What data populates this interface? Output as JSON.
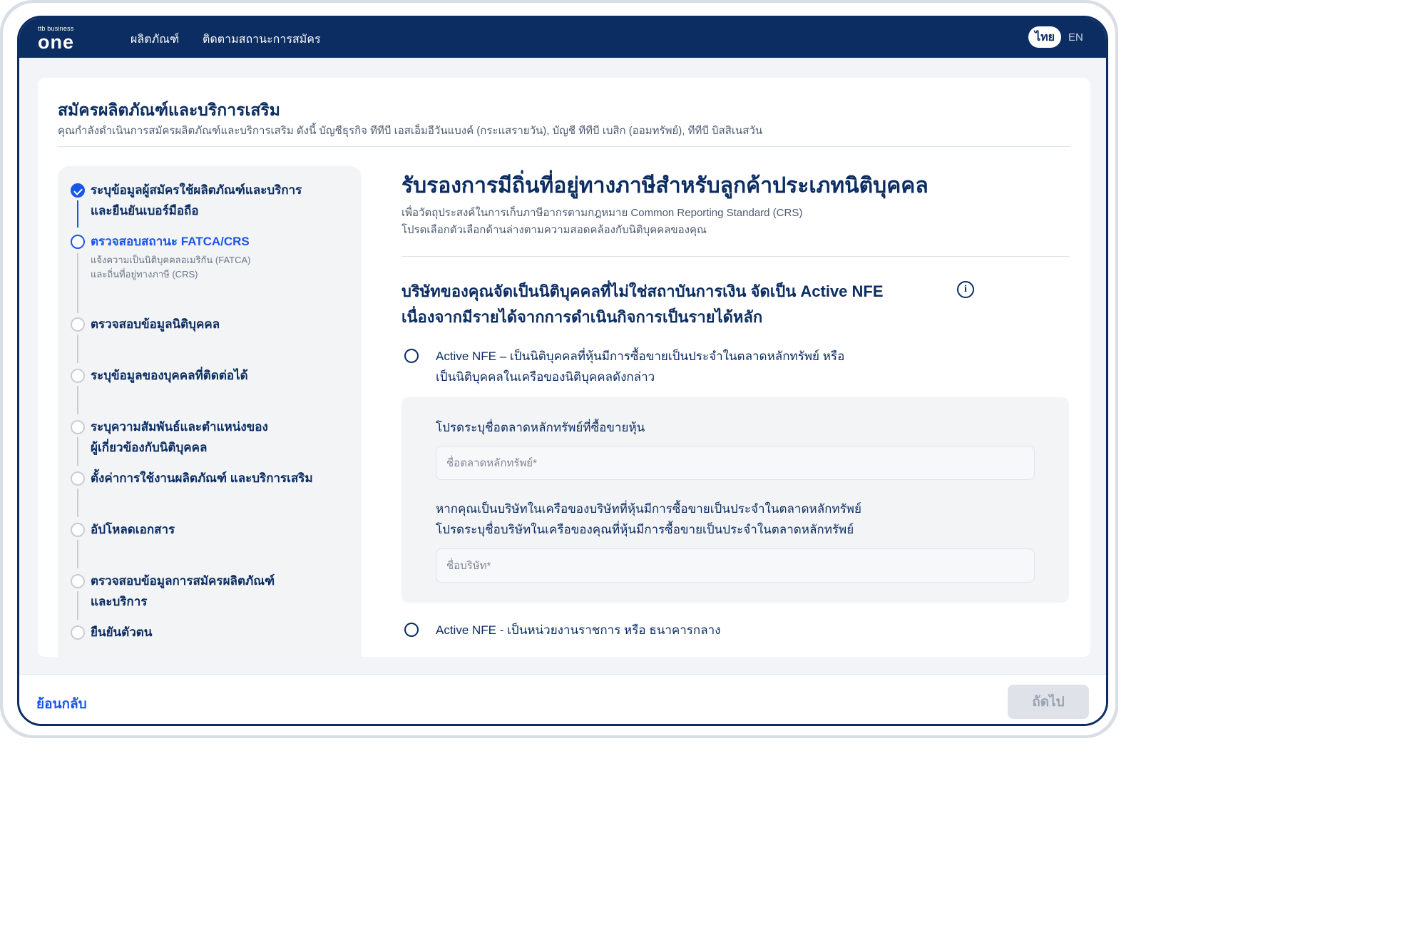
{
  "header": {
    "logo_small": "ttb business",
    "logo_big": "one",
    "nav": [
      "ผลิตภัณฑ์",
      "ติดตามสถานะการสมัคร"
    ],
    "lang_active": "ไทย",
    "lang_other": "EN"
  },
  "page": {
    "title": "สมัครผลิตภัณฑ์และบริการเสริม",
    "subtitle": "คุณกำลังดำเนินการสมัครผลิตภัณฑ์และบริการเสริม ดังนี้  บัญชีธุรกิจ ทีทีบี เอสเอ็มอีวันแบงค์ (กระแสรายวัน),  บัญชี ทีทีบี เบสิก (ออมทรัพย์),  ทีทีบี บิสสิเนสวัน"
  },
  "steps": [
    {
      "label": "ระบุข้อมูลผู้สมัครใช้ผลิตภัณฑ์และบริการ\nและยืนยันเบอร์มือถือ",
      "state": "done"
    },
    {
      "label": "ตรวจสอบสถานะ FATCA/CRS",
      "desc": "แจ้งความเป็นนิติบุคคลอเมริกัน (FATCA)\nและถิ่นที่อยู่ทางภาษี (CRS)",
      "state": "active"
    },
    {
      "label": "ตรวจสอบข้อมูลนิติบุคคล",
      "state": "pending"
    },
    {
      "label": "ระบุข้อมูลของบุคคลที่ติดต่อได้",
      "state": "pending"
    },
    {
      "label": "ระบุความสัมพันธ์และตำแหน่งของ\nผู้เกี่ยวข้องกับนิติบุคคล",
      "state": "pending"
    },
    {
      "label": "ตั้งค่าการใช้งานผลิตภัณฑ์ และบริการเสริม",
      "state": "pending"
    },
    {
      "label": "อัปโหลดเอกสาร",
      "state": "pending"
    },
    {
      "label": "ตรวจสอบข้อมูลการสมัครผลิตภัณฑ์\nและบริการ",
      "state": "pending"
    },
    {
      "label": "ยืนยันตัวตน",
      "state": "pending"
    }
  ],
  "content": {
    "heading": "รับรองการมีถิ่นที่อยู่ทางภาษีสำหรับลูกค้าประเภทนิติบุคคล",
    "intro_line1": "เพื่อวัตถุประสงค์ในการเก็บภาษีอากรตามกฎหมาย  Common Reporting Standard (CRS)",
    "intro_line2": "โปรดเลือกตัวเลือกด้านล่างตามความสอดคล้องกับนิติบุคคลของคุณ",
    "question": "บริษัทของคุณจัดเป็นนิติบุคคลที่ไม่ใช่สถาบันการเงิน จัดเป็น Active NFE\nเนื่องจากมีรายได้จากการดำเนินกิจการเป็นรายได้หลัก",
    "info_icon": "i",
    "options": [
      "Active NFE – เป็นนิติบุคคลที่หุ้นมีการซื้อขายเป็นประจำในตลาดหลักทรัพย์ หรือ\nเป็นนิติบุคคลในเครือของนิติบุคคลดังกล่าว",
      "Active NFE - เป็นหน่วยงานราชการ หรือ ธนาคารกลาง"
    ],
    "sub": {
      "label1": "โปรดระบุชื่อตลาดหลักทรัพย์ที่ซื้อขายหุ้น",
      "placeholder1": "ชื่อตลาดหลักทรัพย์*",
      "label2": "หากคุณเป็นบริษัทในเครือของบริษัทที่หุ้นมีการซื้อขายเป็นประจำในตลาดหลักทรัพย์\nโปรดระบุชื่อบริษัทในเครือของคุณที่หุ้นมีการซื้อขายเป็นประจำในตลาดหลักทรัพย์",
      "placeholder2": "ชื่อบริษัท*"
    }
  },
  "footer": {
    "back": "ย้อนกลับ",
    "next": "ถัดไป"
  },
  "colors": {
    "brand_navy": "#0b2d62",
    "accent_blue": "#1a56e8"
  }
}
